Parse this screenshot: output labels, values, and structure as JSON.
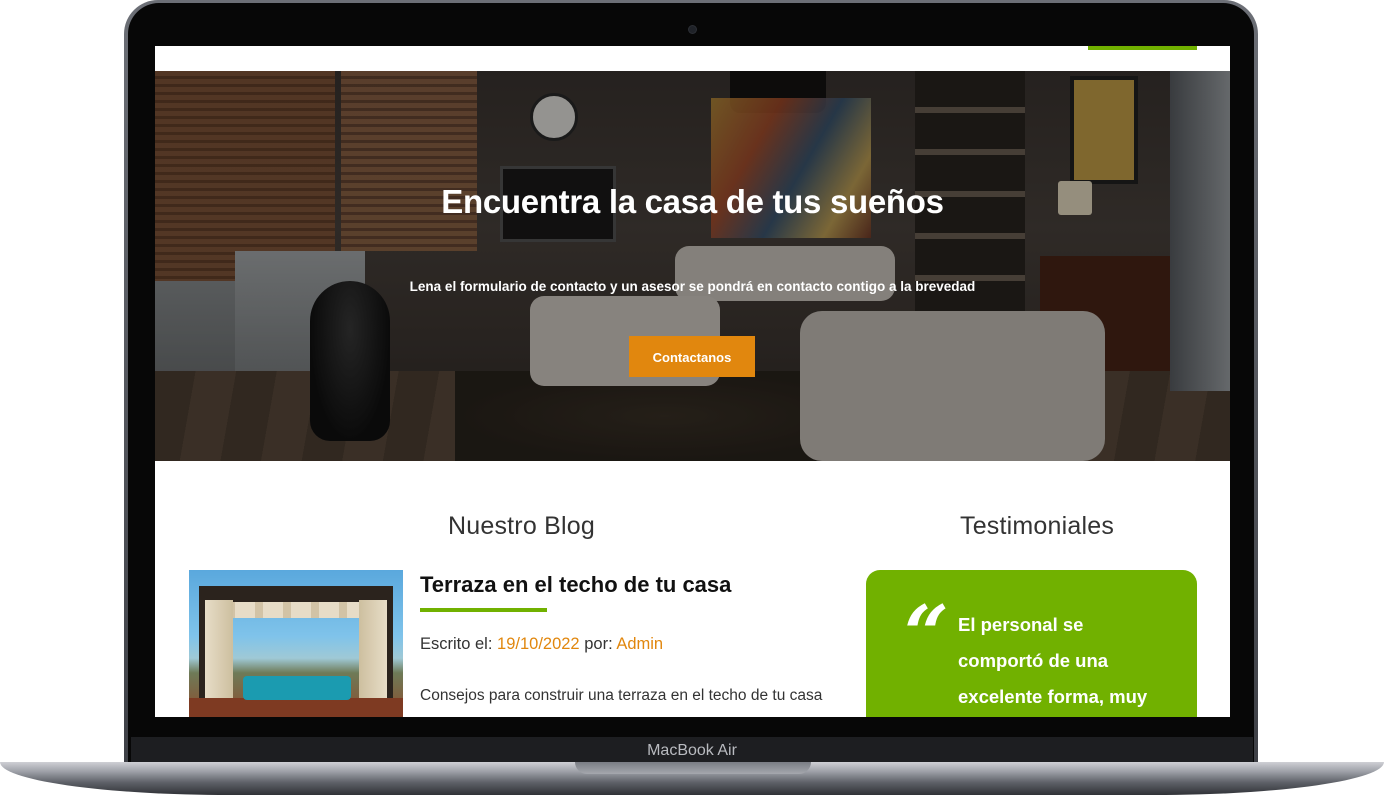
{
  "device": {
    "label": "MacBook Air"
  },
  "hero": {
    "title": "Encuentra la casa de tus sueños",
    "subtitle": "Lena el formulario de contacto y un asesor se pondrá en contacto contigo a la brevedad",
    "cta_label": "Contactanos"
  },
  "blog": {
    "section_title": "Nuestro Blog",
    "post": {
      "title": "Terraza en el techo de tu casa",
      "written_label": "Escrito el:",
      "date": "19/10/2022",
      "by_label": "por:",
      "author": "Admin",
      "excerpt": "Consejos para construir una terraza en el techo de tu casa"
    }
  },
  "testimonials": {
    "section_title": "Testimoniales",
    "quote_glyph": "“",
    "text": "El personal se comportó de una excelente forma, muy"
  },
  "colors": {
    "accent_green": "#71b100",
    "accent_orange": "#e1870e"
  }
}
